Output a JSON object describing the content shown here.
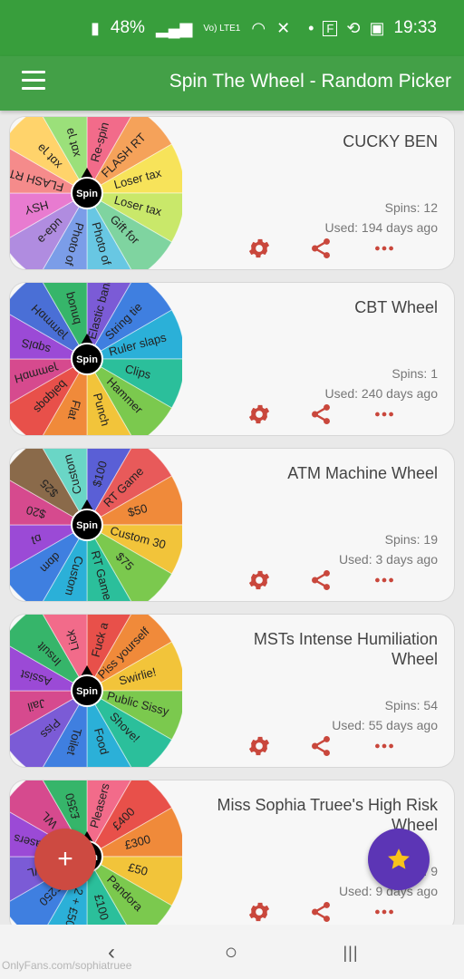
{
  "status_bar": {
    "time": "19:33",
    "battery": "48%",
    "network": "Vo) LTE1",
    "notif_letter": "F"
  },
  "app_bar": {
    "title": "Spin The Wheel - Random Picker"
  },
  "wheel_center_label": "Spin",
  "wheels": [
    {
      "title": "CUCKY BEN",
      "spins": "Spins: 12",
      "used": "Used: 194 days ago",
      "palette": [
        "#f26b8a",
        "#f5a25a",
        "#f7e35a",
        "#c9e86a",
        "#7fd4a0",
        "#68c7e3",
        "#7b9de8",
        "#b08ce0",
        "#e87bd0",
        "#f58b8b",
        "#ffd36b",
        "#9be07a"
      ],
      "slices": [
        "Re-spin",
        "FLASH RT",
        "Loser tax",
        "Loser tax",
        "Gift for",
        "Photo of",
        "Photo of",
        "udə-ə",
        "HSY",
        "FLASH RT",
        "xɒt ɿə",
        "xɒt ɿə"
      ]
    },
    {
      "title": "CBT Wheel",
      "spins": "Spins: 1",
      "used": "Used: 240 days ago",
      "palette": [
        "#7b5bd6",
        "#3f7fe0",
        "#2bb0d8",
        "#2bbf9b",
        "#7bc94e",
        "#f2c43a",
        "#f08a3a",
        "#e8504a",
        "#d64a8e",
        "#9b4ad6",
        "#4a6fd6",
        "#36b56a"
      ],
      "slices": [
        "Elastic band",
        "String tie",
        "Ruler slaps",
        "Clips",
        "Hammer",
        "Punch",
        "Flat",
        "bəlqɒqs",
        "ɿəmmɒH",
        "sqɒlS",
        "ɿəmmɒH",
        "bnuoq"
      ]
    },
    {
      "title": "ATM Machine Wheel",
      "spins": "Spins: 19",
      "used": "Used: 3 days ago",
      "palette": [
        "#5a5fd6",
        "#e85a5a",
        "#f08a3a",
        "#f2c43a",
        "#7bc94e",
        "#2bbf9b",
        "#2bb0d8",
        "#3f7fe0",
        "#9b4ad6",
        "#d64a8e",
        "#8a6a4a",
        "#6ad6c6"
      ],
      "slices": [
        "$100",
        "RT Game",
        "$50",
        "Custom 30",
        "$75",
        "RT Game",
        "Custom",
        "dɒm",
        "ɒʇ",
        "$20",
        "$25",
        "Custom"
      ]
    },
    {
      "title": "MSTs Intense Humiliation Wheel",
      "spins": "Spins: 54",
      "used": "Used: 55 days ago",
      "palette": [
        "#e8504a",
        "#f08a3a",
        "#f2c43a",
        "#7bc94e",
        "#2bbf9b",
        "#2bb0d8",
        "#3f7fe0",
        "#7b5bd6",
        "#d64a8e",
        "#9b4ad6",
        "#36b56a",
        "#f26b8a"
      ],
      "slices": [
        "Fuck a",
        "Piss yourself",
        "Swirlie!",
        "Public Sissy",
        "Shove!",
        "Food",
        "Toilet",
        "Piss",
        "Jail",
        "Assist",
        "Insult",
        "Lick"
      ]
    },
    {
      "title": "Miss Sophia Truee's High Risk Wheel",
      "spins": "Spins: 9",
      "used": "Used: 9 days ago",
      "palette": [
        "#f26b8a",
        "#e8504a",
        "#f08a3a",
        "#f2c43a",
        "#7bc94e",
        "#2bbf9b",
        "#2bb0d8",
        "#3f7fe0",
        "#7b5bd6",
        "#9b4ad6",
        "#d64a8e",
        "#36b56a"
      ],
      "slices": [
        "Pleasers",
        "£400",
        "£300",
        "£50",
        "Pandora",
        "£100",
        "2 + £50",
        "£250",
        "WL",
        "Pleasers",
        "WL",
        "£350"
      ]
    }
  ],
  "fab": {
    "add_symbol": "+"
  },
  "nav": {
    "back_symbol": "‹",
    "home_symbol": "○",
    "recents_symbol": "|||"
  },
  "watermark": "OnlyFans.com/sophiatruee",
  "colors": {
    "app_bar": "#43a047",
    "status_bar": "#389e3c",
    "action_icon": "#c9473c",
    "fab_add": "#cd4a41",
    "fab_star": "#5c35b5",
    "star": "#f9c21a"
  }
}
